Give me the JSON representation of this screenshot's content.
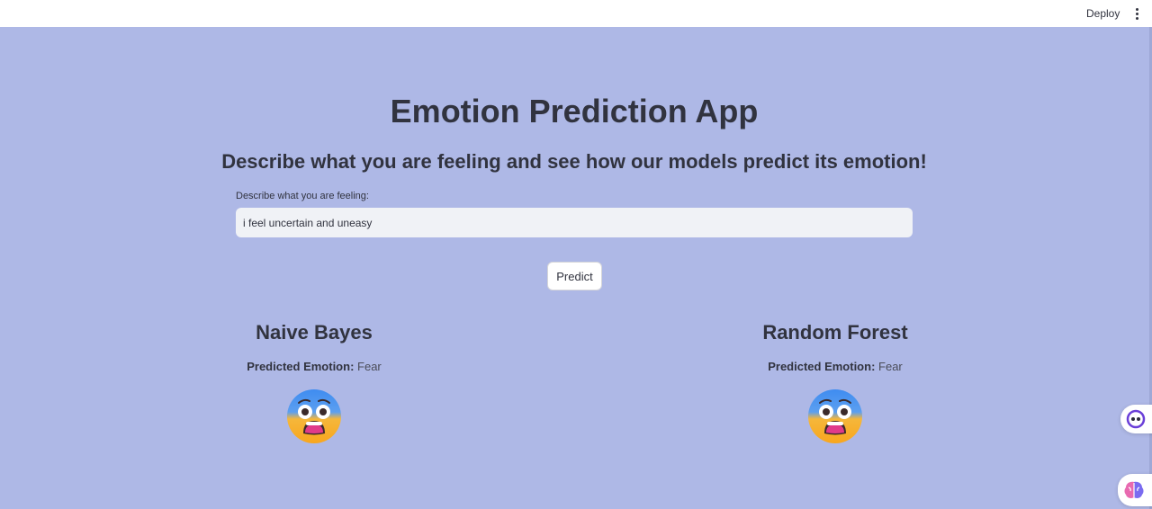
{
  "header": {
    "deploy_label": "Deploy",
    "menu_icon": "kebab-menu-icon"
  },
  "main": {
    "title": "Emotion Prediction App",
    "subtitle": "Describe what you are feeling and see how our models predict its emotion!",
    "input": {
      "label": "Describe what you are feeling:",
      "value": "i feel uncertain and uneasy"
    },
    "predict_button_label": "Predict"
  },
  "results": [
    {
      "model": "Naive Bayes",
      "prefix": "Predicted Emotion:",
      "emotion": "Fear",
      "icon": "fearful-face-icon"
    },
    {
      "model": "Random Forest",
      "prefix": "Predicted Emotion:",
      "emotion": "Fear",
      "icon": "fearful-face-icon"
    }
  ],
  "side_widgets": [
    {
      "icon": "chatbot-icon"
    },
    {
      "icon": "brain-icon"
    }
  ],
  "colors": {
    "background": "#aeb8e6",
    "topbar": "#ffffff",
    "text": "#31333f",
    "input_bg": "#f0f2f6"
  }
}
